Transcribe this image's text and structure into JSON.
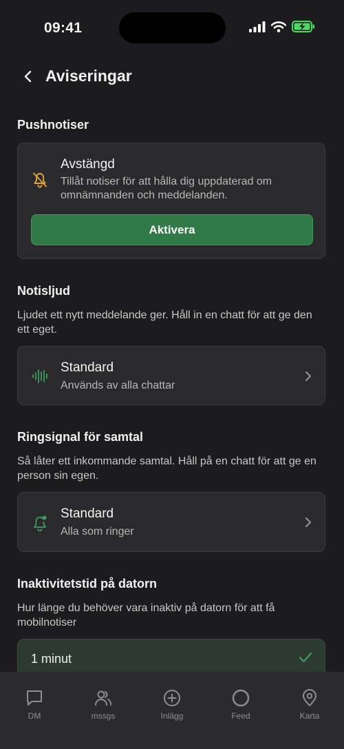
{
  "status_bar": {
    "time": "09:41"
  },
  "header": {
    "title": "Aviseringar"
  },
  "push": {
    "section_title": "Pushnotiser",
    "status_title": "Avstängd",
    "status_desc": "Tillåt notiser för att hålla dig uppdaterad om omnämnanden och meddelanden.",
    "button_label": "Aktivera"
  },
  "sound": {
    "section_title": "Notisljud",
    "desc": "Ljudet ett nytt meddelande ger. Håll in en chatt för att ge den ett eget.",
    "value": "Standard",
    "sub": "Används av alla chattar"
  },
  "ringtone": {
    "section_title": "Ringsignal för samtal",
    "desc": "Så låter ett inkommande samtal. Håll på en chatt för att ge en person sin egen.",
    "value": "Standard",
    "sub": "Alla som ringer"
  },
  "inactivity": {
    "section_title": "Inaktivitetstid på datorn",
    "desc": "Hur länge du behöver vara inaktiv på datorn för att få mobilnotiser",
    "selected_option": "1 minut"
  },
  "tabbar": {
    "tabs": [
      {
        "label": "DM",
        "icon": "chat-bubble-icon"
      },
      {
        "label": "mssgs",
        "icon": "users-icon"
      },
      {
        "label": "Inlägg",
        "icon": "plus-circle-icon"
      },
      {
        "label": "Feed",
        "icon": "circle-icon"
      },
      {
        "label": "Karta",
        "icon": "map-pin-icon"
      }
    ]
  },
  "colors": {
    "background": "#1c1c1e",
    "accent_green": "#2f7a47",
    "warning_icon": "#e0a43a",
    "green_icon": "#3e9a5c"
  }
}
